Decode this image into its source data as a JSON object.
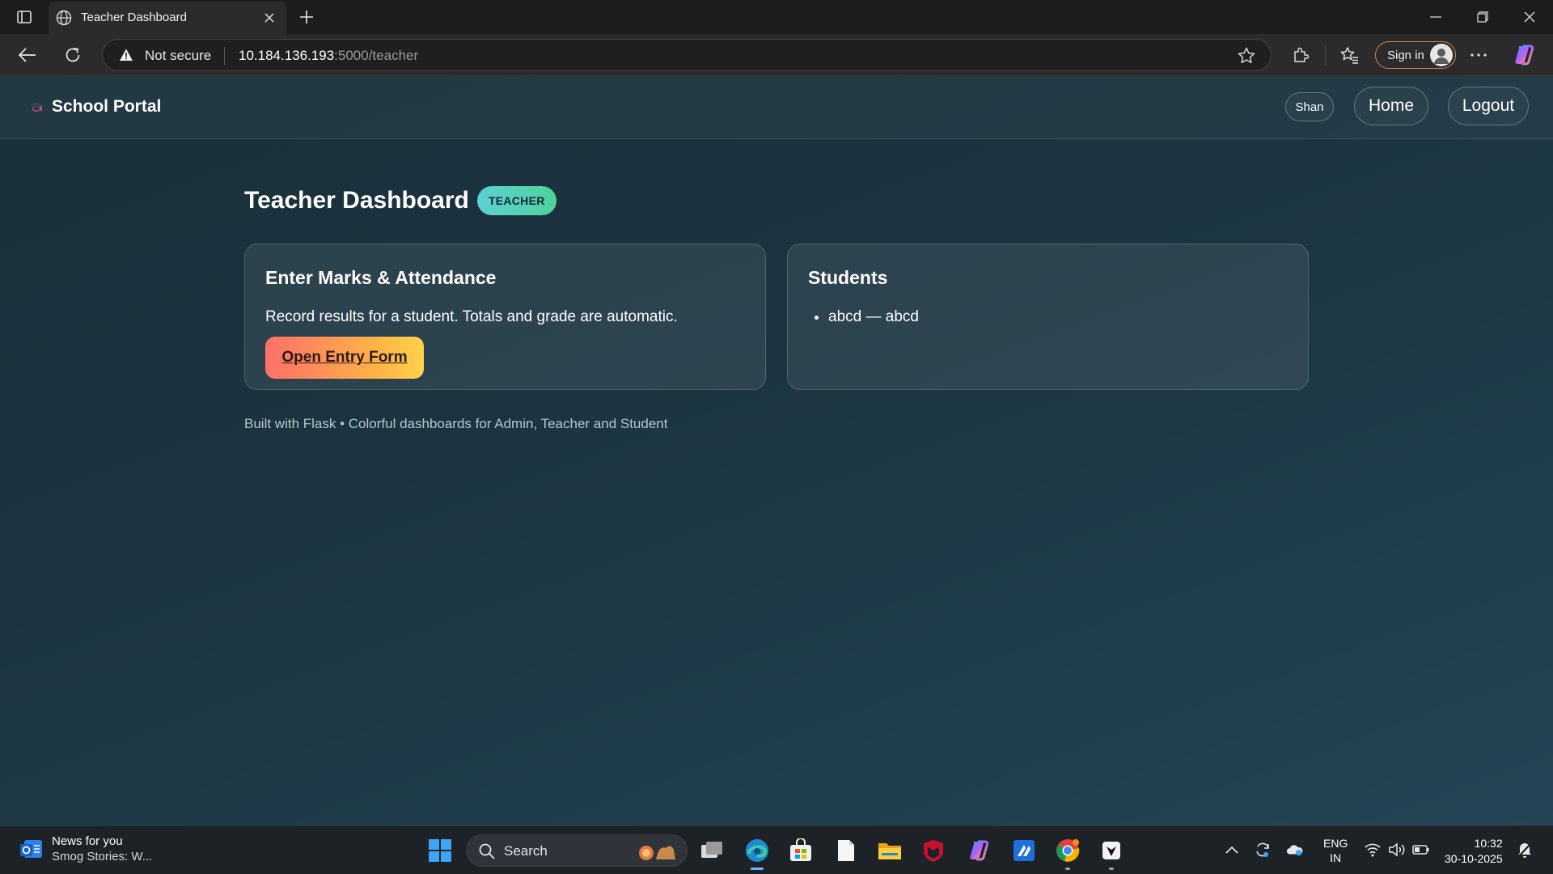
{
  "browser": {
    "tab_title": "Teacher Dashboard",
    "security_label": "Not secure",
    "url_host": "10.184.136.193",
    "url_rest": ":5000/teacher",
    "signin_label": "Sign in",
    "accent_color": "#d9814a"
  },
  "navbar": {
    "brand": "School Portal",
    "user": "Shan",
    "home": "Home",
    "logout": "Logout"
  },
  "main": {
    "title": "Teacher Dashboard",
    "role_badge": "TEACHER",
    "entry_card": {
      "title": "Enter Marks & Attendance",
      "description": "Record results for a student. Totals and grade are automatic.",
      "button": "Open Entry Form"
    },
    "students_card": {
      "title": "Students",
      "items": [
        "abcd — abcd"
      ]
    },
    "footer": "Built with Flask • Colorful dashboards for Admin, Teacher and Student"
  },
  "taskbar": {
    "news_title": "News for you",
    "news_sub": "Smog Stories: W...",
    "search_label": "Search",
    "lang_line1": "ENG",
    "lang_line2": "IN",
    "time": "10:32",
    "date": "30-10-2025"
  }
}
